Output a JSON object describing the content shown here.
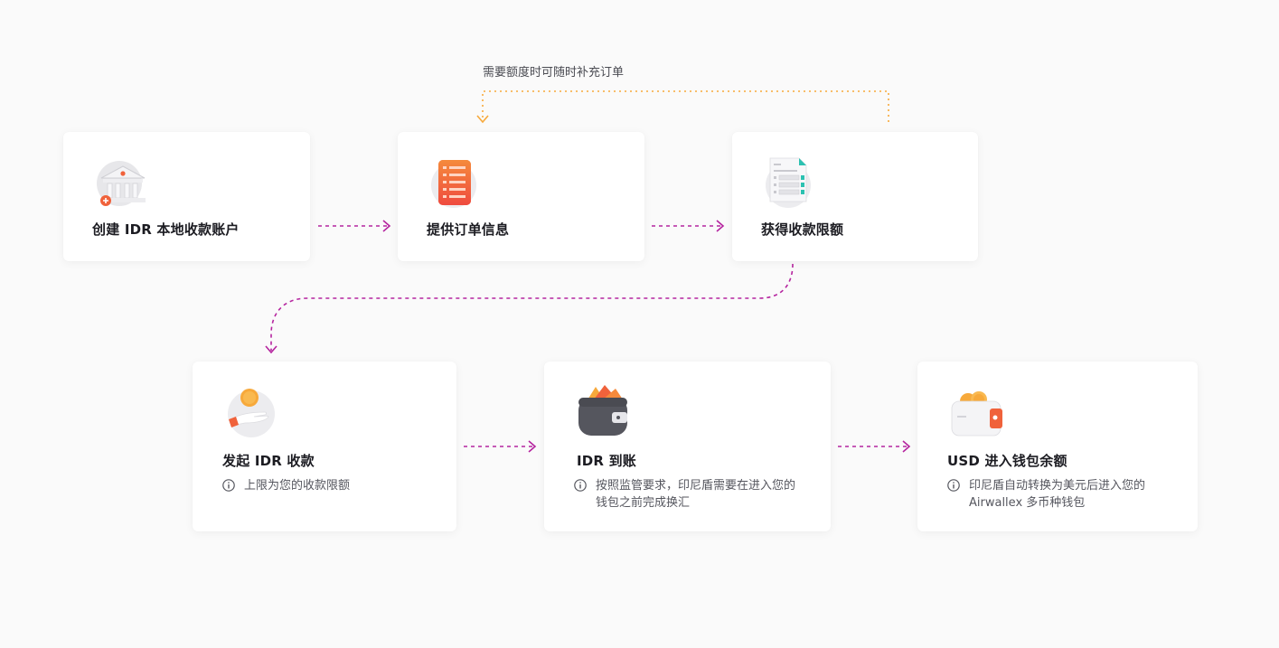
{
  "loop_label": "需要额度时可随时补充订单",
  "steps": [
    {
      "title": "创建 IDR 本地收款账户",
      "note": "",
      "icon": "bank-icon"
    },
    {
      "title": "提供订单信息",
      "note": "",
      "icon": "order-list-icon"
    },
    {
      "title": "获得收款限额",
      "note": "",
      "icon": "document-icon"
    },
    {
      "title": "发起 IDR 收款",
      "note": "上限为您的收款限额",
      "icon": "coin-hand-icon"
    },
    {
      "title": "IDR 到账",
      "note": "按照监管要求，印尼盾需要在进入您的钱包之前完成换汇",
      "icon": "wallet-icon"
    },
    {
      "title": "USD 进入钱包余额",
      "note": "印尼盾自动转换为美元后进入您的 Airwallex 多币种钱包",
      "icon": "coin-wallet-icon"
    }
  ],
  "colors": {
    "flow_arrow": "#b5249f",
    "loop_arrow": "#f7a93b",
    "accent_orange": "#f0623b"
  }
}
